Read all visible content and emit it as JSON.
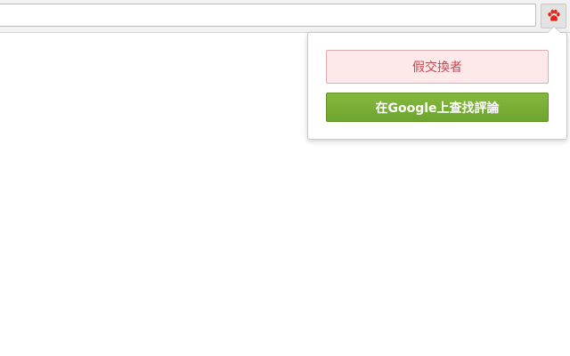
{
  "browser": {
    "address_value": "",
    "extension_icon": "paw-icon",
    "extension_color": "#e3261c"
  },
  "popup": {
    "verdict_label": "假交換者",
    "verdict_color": "#c7474f",
    "google_search_label": "在Google上查找評論",
    "button_color": "#75ab33"
  }
}
